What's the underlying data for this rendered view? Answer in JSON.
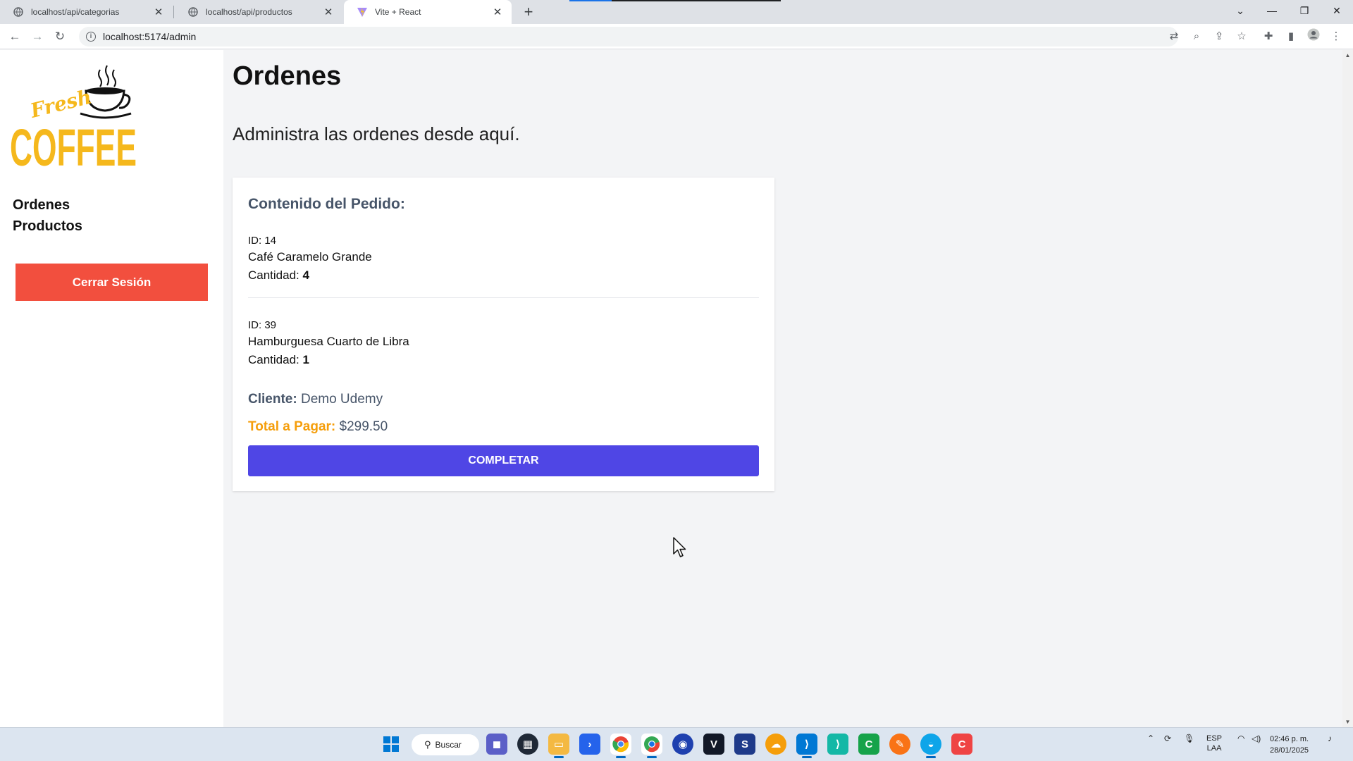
{
  "browser": {
    "tabs": [
      {
        "title": "localhost/api/categorias",
        "favicon": "globe-icon"
      },
      {
        "title": "localhost/api/productos",
        "favicon": "globe-icon"
      },
      {
        "title": "Vite + React",
        "favicon": "vite-icon"
      }
    ],
    "url": "localhost:5174/admin"
  },
  "sidebar": {
    "logo_text_top": "Fresh",
    "logo_text_main": "COFFEE",
    "nav": [
      {
        "label": "Ordenes"
      },
      {
        "label": "Productos"
      }
    ],
    "logout_label": "Cerrar Sesión"
  },
  "main": {
    "title": "Ordenes",
    "subtitle": "Administra las ordenes desde aquí.",
    "order": {
      "heading": "Contenido del Pedido:",
      "items": [
        {
          "id_text": "ID: 14",
          "name": "Café Caramelo Grande",
          "qty_label": "Cantidad:",
          "qty": "4"
        },
        {
          "id_text": "ID: 39",
          "name": "Hamburguesa Cuarto de Libra",
          "qty_label": "Cantidad:",
          "qty": "1"
        }
      ],
      "client_label": "Cliente:",
      "client_name": "Demo Udemy",
      "total_label": "Total a Pagar:",
      "total_value": "$299.50",
      "complete_label": "COMPLETAR"
    }
  },
  "taskbar": {
    "search_label": "Buscar",
    "lang_top": "ESP",
    "lang_bottom": "LAA",
    "time": "02:46 p. m.",
    "date": "28/01/2025"
  },
  "colors": {
    "logout_bg": "#f24f3e",
    "complete_bg": "#4f46e5",
    "total_label": "#f59e0b",
    "logo_yellow": "#f5b81c"
  }
}
